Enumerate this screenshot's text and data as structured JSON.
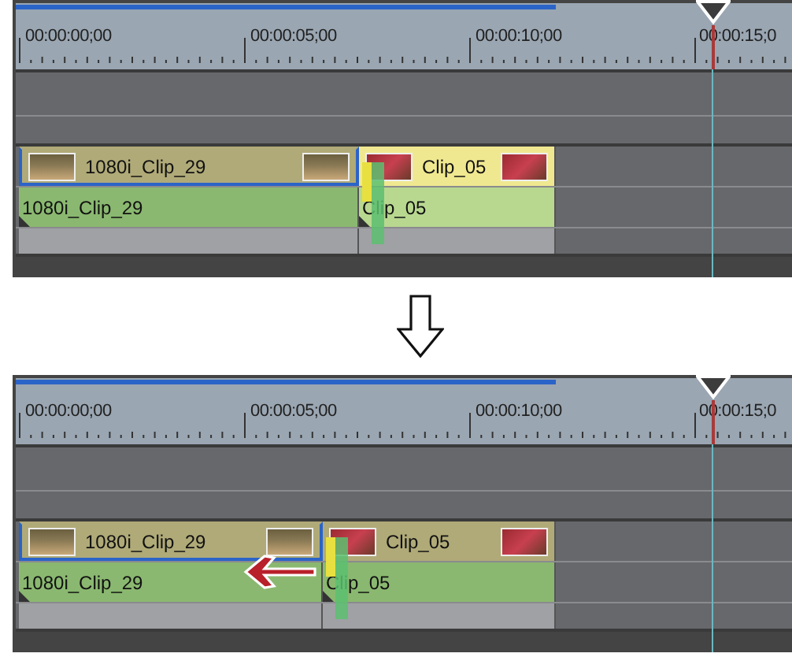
{
  "panels": [
    {
      "timecodes": [
        "00:00:00;00",
        "00:00:05;00",
        "00:00:10;00",
        "00:00:15;0"
      ],
      "trimmed": false,
      "trim_arrow": false,
      "clips": [
        {
          "video_label": "1080i_Clip_29",
          "audio_label": "1080i_Clip_29",
          "selected": true,
          "highlighted": false
        },
        {
          "video_label": "Clip_05",
          "audio_label": "Clip_05",
          "selected": false,
          "highlighted": true
        }
      ]
    },
    {
      "timecodes": [
        "00:00:00;00",
        "00:00:05;00",
        "00:00:10;00",
        "00:00:15;0"
      ],
      "trimmed": true,
      "trim_arrow": true,
      "clips": [
        {
          "video_label": "1080i_Clip_29",
          "audio_label": "1080i_Clip_29",
          "selected": true,
          "highlighted": false
        },
        {
          "video_label": "Clip_05",
          "audio_label": "Clip_05",
          "selected": false,
          "highlighted": false
        }
      ]
    }
  ]
}
